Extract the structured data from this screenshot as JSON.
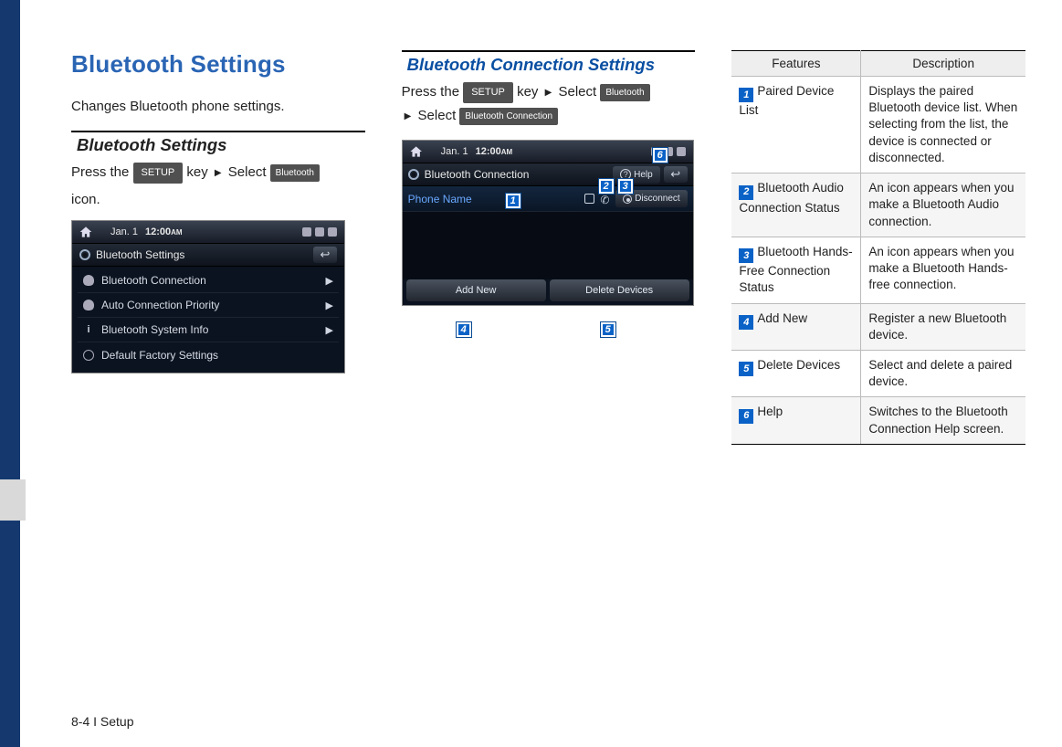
{
  "page": {
    "footer": "8-4 I Setup"
  },
  "col1": {
    "title": "Bluetooth Settings",
    "intro": "Changes Bluetooth phone settings.",
    "sub": "Bluetooth Settings",
    "instr_pre": "Press the",
    "key_setup": "SETUP",
    "instr_mid": "key",
    "instr_select": "Select",
    "key_bt": "Bluetooth",
    "instr_icon": "icon.",
    "screen": {
      "date": "Jan.  1",
      "time": "12:00",
      "ampm": "AM",
      "header": "Bluetooth Settings",
      "items": [
        "Bluetooth Connection",
        "Auto Connection Priority",
        "Bluetooth System Info",
        "Default Factory Settings"
      ]
    }
  },
  "col2": {
    "title": "Bluetooth Connection Settings",
    "instr_pre": "Press the",
    "key_setup": "SETUP",
    "instr_key": "key",
    "instr_select1": "Select",
    "key_bt": "Bluetooth",
    "instr_select2": "Select",
    "key_btc": "Bluetooth Connection",
    "screen": {
      "date": "Jan.  1",
      "time": "12:00",
      "ampm": "AM",
      "header": "Bluetooth Connection",
      "help": "Help",
      "phone": "Phone Name",
      "disconnect": "Disconnect",
      "addnew": "Add New",
      "delete": "Delete Devices"
    },
    "callouts": {
      "c1": "1",
      "c2": "2",
      "c3": "3",
      "c4": "4",
      "c5": "5",
      "c6": "6"
    }
  },
  "table": {
    "h1": "Features",
    "h2": "Description",
    "rows": [
      {
        "n": "1",
        "f": "Paired Device List",
        "d": "Displays the paired Bluetooth device list. When selecting from the list, the device is connected or disconnected."
      },
      {
        "n": "2",
        "f": "Bluetooth Audio Connection Status",
        "d": "An icon appears when you make a Bluetooth Audio connection."
      },
      {
        "n": "3",
        "f": "Bluetooth Hands-Free Connection Status",
        "d": "An icon appears when you make a Bluetooth Hands-free connection."
      },
      {
        "n": "4",
        "f": "Add New",
        "d": "Register a new Bluetooth device."
      },
      {
        "n": "5",
        "f": "Delete Devices",
        "d": "Select and delete a paired device."
      },
      {
        "n": "6",
        "f": "Help",
        "d": "Switches to the Bluetooth Connection Help screen."
      }
    ]
  }
}
